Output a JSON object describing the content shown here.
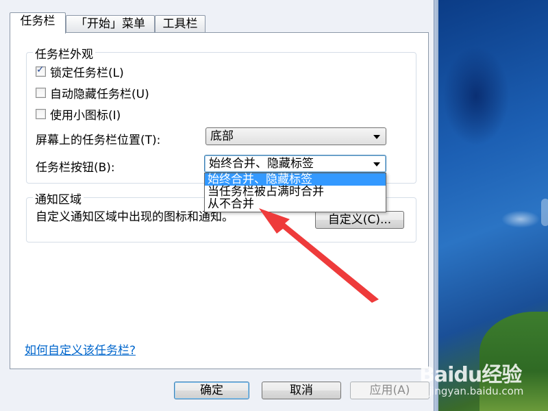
{
  "tabs": [
    {
      "label": "任务栏",
      "active": true
    },
    {
      "label": "「开始」菜单",
      "active": false
    },
    {
      "label": "工具栏",
      "active": false
    }
  ],
  "appearance": {
    "title": "任务栏外观",
    "lock_taskbar": {
      "label": "锁定任务栏(L)",
      "checked": true
    },
    "auto_hide": {
      "label": "自动隐藏任务栏(U)",
      "checked": false
    },
    "small_icons": {
      "label": "使用小图标(I)",
      "checked": false
    },
    "location_label": "屏幕上的任务栏位置(T):",
    "location_value": "底部",
    "buttons_label": "任务栏按钮(B):",
    "buttons_value": "始终合并、隐藏标签",
    "buttons_options": [
      "始终合并、隐藏标签",
      "当任务栏被占满时合并",
      "从不合并"
    ]
  },
  "notification": {
    "title": "通知区域",
    "description": "自定义通知区域中出现的图标和通知。",
    "customize_button": "自定义(C)..."
  },
  "help_link": "如何自定义该任务栏?",
  "footer": {
    "ok": "确定",
    "cancel": "取消",
    "apply": "应用(A)"
  },
  "watermark": {
    "logo": "Baidu经验",
    "url": "jingyan.baidu.com"
  },
  "colors": {
    "selection": "#3399ff",
    "annotation_arrow": "#ee3b3b",
    "link": "#0066cc"
  }
}
